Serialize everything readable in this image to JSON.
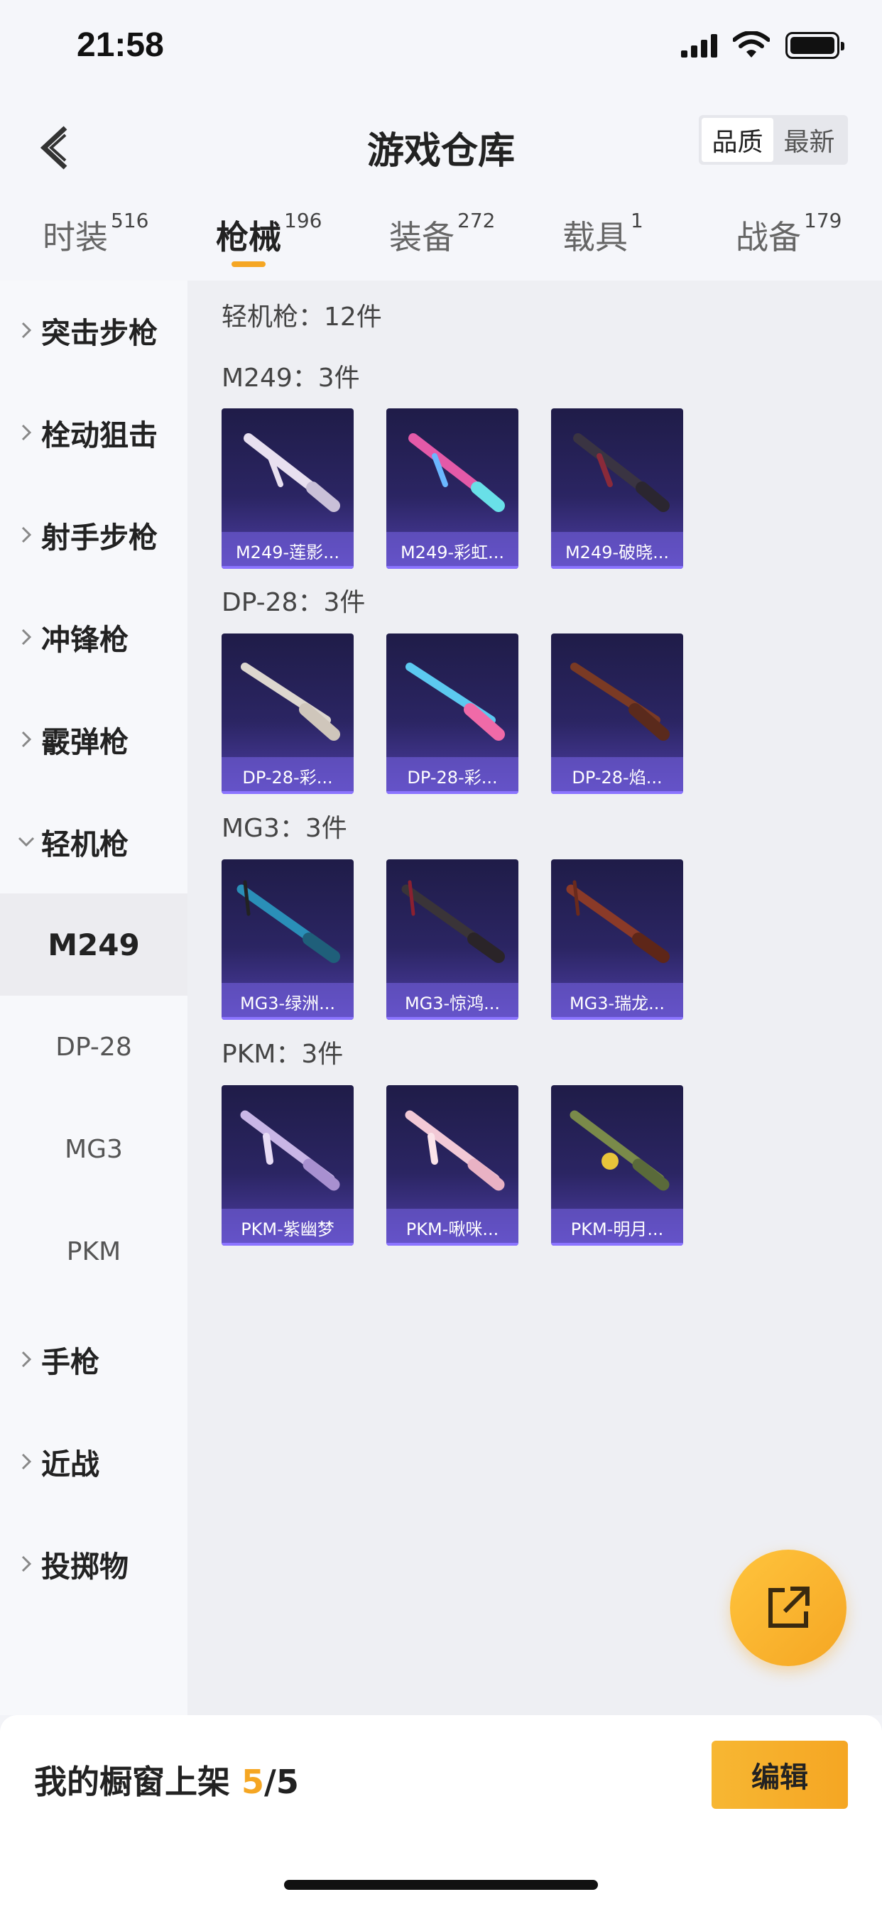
{
  "status_bar": {
    "time": "21:58"
  },
  "header": {
    "title": "游戏仓库",
    "sort_options": [
      "品质",
      "最新"
    ]
  },
  "tabs": [
    {
      "label": "时装",
      "count": "516"
    },
    {
      "label": "枪械",
      "count": "196"
    },
    {
      "label": "装备",
      "count": "272"
    },
    {
      "label": "载具",
      "count": "1"
    },
    {
      "label": "战备",
      "count": "179"
    }
  ],
  "sidebar": {
    "categories_top": [
      "突击步枪",
      "栓动狙击",
      "射手步枪",
      "冲锋枪",
      "霰弹枪",
      "轻机枪"
    ],
    "subcategories": [
      "M249",
      "DP-28",
      "MG3",
      "PKM"
    ],
    "categories_bottom": [
      "手枪",
      "近战",
      "投掷物"
    ]
  },
  "content": {
    "summary": "轻机枪：12件",
    "groups": [
      {
        "heading": "M249：3件",
        "items": [
          "M249-莲影...",
          "M249-彩虹...",
          "M249-破晓..."
        ]
      },
      {
        "heading": "DP-28：3件",
        "items": [
          "DP-28-彩...",
          "DP-28-彩...",
          "DP-28-焰..."
        ]
      },
      {
        "heading": "MG3：3件",
        "items": [
          "MG3-绿洲...",
          "MG3-惊鸿...",
          "MG3-瑞龙..."
        ]
      },
      {
        "heading": "PKM：3件",
        "items": [
          "PKM-紫幽梦",
          "PKM-啾咪...",
          "PKM-明月..."
        ]
      }
    ]
  },
  "bottom_bar": {
    "label": "我的橱窗上架",
    "current": "5",
    "total": "/5",
    "edit_label": "编辑"
  },
  "colors": {
    "accent": "#f5a623",
    "card_dark": "#1f1c48",
    "card_light": "#4f3fa8"
  }
}
